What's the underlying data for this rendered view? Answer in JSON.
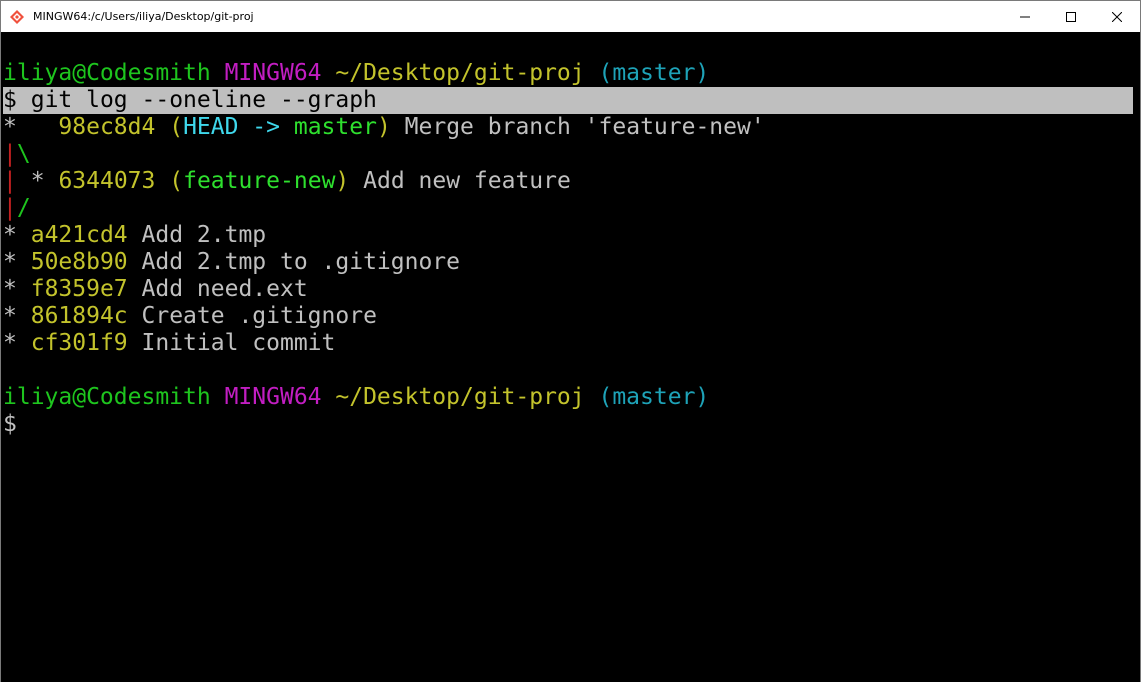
{
  "window": {
    "title": "MINGW64:/c/Users/iliya/Desktop/git-proj",
    "icon": "git-bash-icon",
    "controls": {
      "minimize_icon": "minimize-icon",
      "maximize_icon": "maximize-icon",
      "close_icon": "close-icon"
    }
  },
  "colors": {
    "terminal_bg": "#000000",
    "user_host": "#1ec51e",
    "system": "#c21ec2",
    "path": "#c3c32c",
    "branch": "#1ea3b8",
    "text": "#c0c0c0",
    "graph_red": "#c12020",
    "head": "#3fd8ec",
    "ref_green": "#2ee02e",
    "selection": "#bfbfbf"
  },
  "prompt1": {
    "user_host": "iliya@Codesmith",
    "system": "MINGW64",
    "path": "~/Desktop/git-proj",
    "branch": "(master)"
  },
  "command": {
    "symbol": "$",
    "text": "git log --oneline --graph"
  },
  "log": {
    "merge": {
      "graph": "*",
      "hash": "98ec8d4",
      "open_paren": "(",
      "head": "HEAD ->",
      "ref": "master",
      "close_paren": ")",
      "message": "Merge branch 'feature-new'"
    },
    "branch_open": {
      "pipe": "|",
      "slash": "\\"
    },
    "feature": {
      "pipe": "|",
      "graph": "*",
      "hash": "6344073",
      "open_paren": "(",
      "ref": "feature-new",
      "close_paren": ")",
      "message": "Add new feature"
    },
    "branch_close": {
      "pipe": "|",
      "slash": "/"
    },
    "commits": [
      {
        "graph": "*",
        "hash": "a421cd4",
        "message": "Add 2.tmp"
      },
      {
        "graph": "*",
        "hash": "50e8b90",
        "message": "Add 2.tmp to .gitignore"
      },
      {
        "graph": "*",
        "hash": "f8359e7",
        "message": "Add need.ext"
      },
      {
        "graph": "*",
        "hash": "861894c",
        "message": "Create .gitignore"
      },
      {
        "graph": "*",
        "hash": "cf301f9",
        "message": "Initial commit"
      }
    ]
  },
  "prompt2": {
    "user_host": "iliya@Codesmith",
    "system": "MINGW64",
    "path": "~/Desktop/git-proj",
    "branch": "(master)",
    "symbol": "$"
  }
}
